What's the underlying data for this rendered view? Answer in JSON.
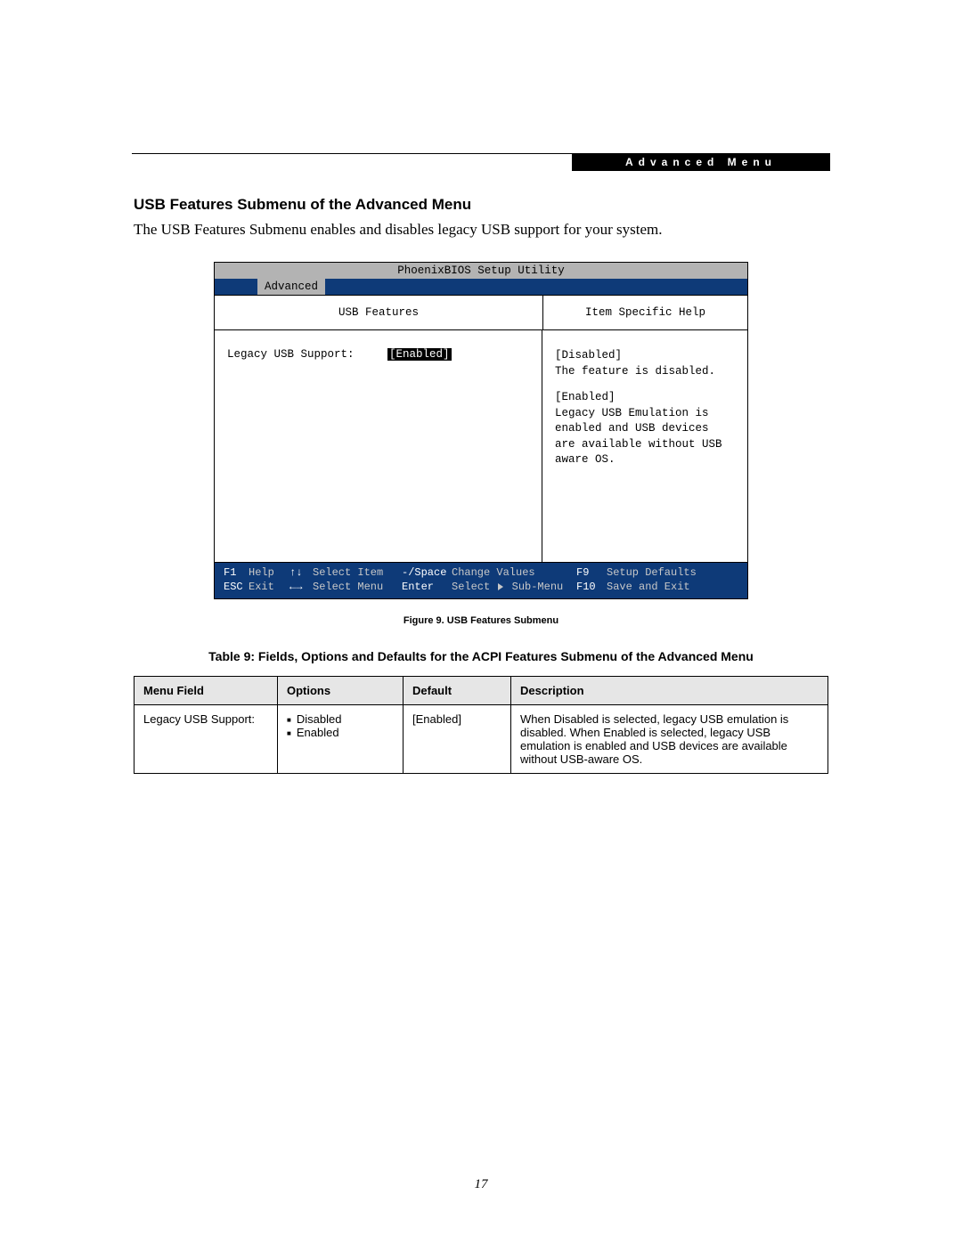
{
  "header_band": "Advanced Menu",
  "section_heading": "USB Features Submenu of the Advanced Menu",
  "intro_text": "The USB Features Submenu enables and disables legacy USB support for your system.",
  "bios": {
    "utility_title": "PhoenixBIOS Setup Utility",
    "active_tab": "Advanced",
    "panel_title": "USB Features",
    "help_title": "Item Specific Help",
    "field_label": "Legacy USB Support:",
    "field_value": "[Enabled]",
    "help_disabled_head": "[Disabled]",
    "help_disabled_body": "The feature is disabled.",
    "help_enabled_head": "[Enabled]",
    "help_enabled_body": "Legacy USB Emulation is enabled and USB devices are available without USB aware OS.",
    "footer": {
      "f1": "F1",
      "f1_label": "Help",
      "updown": "↑↓",
      "updown_label": "Select Item",
      "minus_space": "-/Space",
      "minus_space_label": "Change Values",
      "f9": "F9",
      "f9_label": "Setup Defaults",
      "esc": "ESC",
      "esc_label": "Exit",
      "leftright": "←→",
      "leftright_label": "Select Menu",
      "enter": "Enter",
      "enter_label": "Select ▶ Sub-Menu",
      "f10": "F10",
      "f10_label": "Save and Exit"
    }
  },
  "figure_caption": "Figure 9.  USB Features Submenu",
  "table_caption": "Table 9: Fields, Options and Defaults for the ACPI Features Submenu of the Advanced Menu",
  "table": {
    "headers": {
      "menu": "Menu Field",
      "options": "Options",
      "default": "Default",
      "desc": "Description"
    },
    "rows": [
      {
        "menu": "Legacy USB Support:",
        "options": [
          "Disabled",
          "Enabled"
        ],
        "default": "[Enabled]",
        "desc": "When Disabled is selected, legacy USB emulation is disabled. When Enabled is selected, legacy USB emulation is enabled and USB devices are available without USB-aware OS."
      }
    ]
  },
  "page_number": "17"
}
